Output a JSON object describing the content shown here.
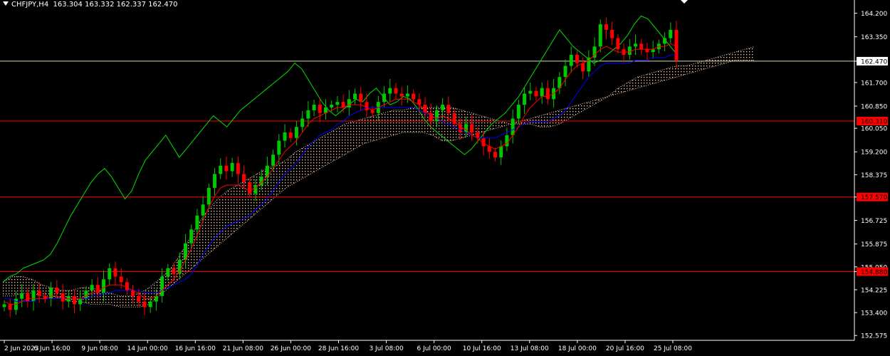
{
  "header": {
    "symbol": "CHFJPY,H4",
    "ohlc": "163.304 163.332 162.337 162.470"
  },
  "chart_data": {
    "type": "candlestick",
    "symbol": "CHFJPY",
    "timeframe": "H4",
    "ylim": [
      152.4,
      164.6
    ],
    "y_ticks": [
      "164.200",
      "163.350",
      "162.470",
      "161.700",
      "160.850",
      "160.050",
      "159.200",
      "158.375",
      "157.570",
      "156.725",
      "155.875",
      "155.050",
      "154.880",
      "154.225",
      "153.400",
      "152.575"
    ],
    "x_ticks": [
      "2 Jun 2023",
      "6 Jun 16:00",
      "9 Jun 08:00",
      "14 Jun 00:00",
      "16 Jun 16:00",
      "21 Jun 08:00",
      "26 Jun 00:00",
      "28 Jun 16:00",
      "3 Jul 08:00",
      "6 Jul 00:00",
      "10 Jul 16:00",
      "13 Jul 08:00",
      "18 Jul 00:00",
      "20 Jul 16:00",
      "25 Jul 08:00"
    ],
    "horizontal_lines": [
      {
        "label": "162.470",
        "price": 162.47,
        "color": "#d8d8a8",
        "label_bg": "#ffffff",
        "label_color": "#000000"
      },
      {
        "label": "160.310",
        "price": 160.31,
        "color": "#ff0000",
        "label_bg": "#ff0000",
        "label_color": "#000000"
      },
      {
        "label": "157.570",
        "price": 157.57,
        "color": "#ff0000",
        "label_bg": "#ff0000",
        "label_color": "#000000"
      },
      {
        "label": "154.880",
        "price": 154.88,
        "color": "#ff0000",
        "label_bg": "#ff0000",
        "label_color": "#000000"
      }
    ],
    "candles": {
      "up_color": "#00c800",
      "down_color": "#ff0000",
      "closes": [
        153.7,
        153.5,
        153.9,
        154.1,
        153.8,
        154.2,
        154.0,
        153.9,
        154.3,
        154.1,
        153.8,
        154.0,
        153.7,
        153.9,
        154.2,
        154.4,
        154.1,
        154.6,
        155.0,
        154.7,
        154.5,
        154.2,
        154.0,
        153.8,
        153.6,
        153.8,
        154.0,
        154.7,
        155.0,
        154.8,
        155.3,
        155.9,
        156.4,
        156.9,
        157.3,
        157.9,
        158.4,
        158.7,
        158.5,
        158.8,
        158.4,
        158.1,
        157.7,
        158.0,
        158.3,
        158.7,
        159.1,
        159.6,
        159.9,
        159.7,
        160.1,
        160.4,
        160.7,
        160.9,
        160.6,
        160.8,
        160.9,
        161.0,
        160.8,
        161.1,
        161.3,
        161.0,
        160.7,
        160.6,
        161.0,
        161.3,
        161.5,
        161.3,
        161.2,
        161.3,
        161.1,
        160.9,
        160.6,
        160.3,
        160.7,
        160.9,
        160.6,
        160.2,
        159.9,
        160.2,
        159.9,
        159.7,
        159.4,
        159.2,
        159.0,
        159.4,
        159.8,
        160.4,
        160.9,
        161.3,
        161.4,
        161.2,
        161.5,
        161.1,
        161.5,
        161.9,
        162.3,
        162.7,
        162.4,
        162.1,
        162.6,
        163.0,
        163.8,
        163.6,
        163.3,
        162.9,
        162.7,
        163.0,
        163.1,
        162.9,
        162.8,
        162.9,
        163.1,
        163.3,
        163.6,
        162.5
      ]
    },
    "indicators": [
      {
        "name": "",
        "type": "ichimoku_tenkan",
        "color": "#ff0000",
        "values": [
          153.8,
          153.7,
          153.7,
          153.8,
          153.9,
          153.9,
          153.9,
          153.9,
          154.0,
          154.0,
          153.9,
          153.9,
          153.9,
          153.9,
          154.0,
          154.1,
          154.2,
          154.3,
          154.4,
          154.4,
          154.4,
          154.3,
          154.2,
          154.1,
          153.9,
          153.9,
          154.0,
          154.2,
          154.4,
          154.6,
          154.9,
          155.3,
          155.7,
          156.2,
          156.7,
          157.2,
          157.6,
          157.9,
          158.0,
          158.0,
          158.0,
          157.9,
          157.8,
          157.9,
          158.1,
          158.3,
          158.6,
          158.9,
          159.2,
          159.4,
          159.6,
          159.9,
          160.2,
          160.4,
          160.5,
          160.6,
          160.7,
          160.8,
          160.8,
          160.9,
          160.9,
          160.9,
          160.8,
          160.7,
          160.8,
          160.9,
          161.0,
          161.1,
          161.1,
          161.1,
          161.0,
          160.9,
          160.7,
          160.5,
          160.4,
          160.5,
          160.4,
          160.3,
          160.1,
          160.0,
          159.8,
          159.7,
          159.5,
          159.4,
          159.3,
          159.4,
          159.5,
          159.8,
          160.1,
          160.5,
          160.8,
          161.0,
          161.2,
          161.2,
          161.3,
          161.5,
          161.8,
          162.1,
          162.3,
          162.4,
          162.5,
          162.7,
          162.9,
          163.0,
          162.9,
          162.8,
          162.8,
          162.8,
          162.9,
          162.9,
          162.9,
          162.9,
          163.0,
          163.0,
          163.1,
          163.0
        ]
      },
      {
        "name": "",
        "type": "ichimoku_kijun",
        "color": "#0000ff",
        "values": [
          153.9,
          153.9,
          153.8,
          153.8,
          153.8,
          153.8,
          153.9,
          153.9,
          153.9,
          153.9,
          153.9,
          153.9,
          153.9,
          153.9,
          153.9,
          154.0,
          154.0,
          154.1,
          154.1,
          154.2,
          154.2,
          154.2,
          154.2,
          154.2,
          154.1,
          154.1,
          154.1,
          154.2,
          154.3,
          154.4,
          154.5,
          154.6,
          154.8,
          155.1,
          155.5,
          155.8,
          156.1,
          156.3,
          156.5,
          156.6,
          156.7,
          156.8,
          156.9,
          157.1,
          157.3,
          157.5,
          157.8,
          158.1,
          158.4,
          158.6,
          158.8,
          159.1,
          159.4,
          159.6,
          159.8,
          159.9,
          160.0,
          160.2,
          160.3,
          160.5,
          160.6,
          160.7,
          160.8,
          160.8,
          160.8,
          160.8,
          160.8,
          160.8,
          160.8,
          160.8,
          160.8,
          160.7,
          160.6,
          160.5,
          160.4,
          160.3,
          160.2,
          160.1,
          160.0,
          159.9,
          159.8,
          159.7,
          159.7,
          159.7,
          159.7,
          159.8,
          159.9,
          160.0,
          160.1,
          160.2,
          160.3,
          160.3,
          160.3,
          160.3,
          160.4,
          160.5,
          160.7,
          161.0,
          161.3,
          161.6,
          161.9,
          162.1,
          162.3,
          162.4,
          162.4,
          162.4,
          162.4,
          162.4,
          162.5,
          162.5,
          162.5,
          162.6,
          162.6,
          162.6,
          162.7,
          162.7
        ]
      },
      {
        "name": "",
        "type": "ichimoku_chikou",
        "color": "#00e000",
        "values": [
          154.5,
          154.7,
          154.8,
          155.0,
          155.1,
          155.2,
          155.3,
          155.5,
          155.9,
          156.4,
          156.9,
          157.3,
          157.7,
          158.1,
          158.4,
          158.6,
          158.3,
          157.9,
          157.5,
          157.8,
          158.4,
          158.9,
          159.2,
          159.5,
          159.8,
          159.4,
          159.0,
          159.3,
          159.6,
          159.9,
          160.2,
          160.5,
          160.3,
          160.1,
          160.4,
          160.7,
          160.9,
          161.1,
          161.3,
          161.5,
          161.7,
          161.9,
          162.1,
          162.4,
          162.2,
          161.8,
          161.4,
          161.0,
          160.7,
          160.5,
          160.7,
          160.9,
          161.1,
          161.0,
          161.3,
          161.5,
          161.2,
          160.9,
          161.0,
          161.2,
          161.1,
          160.8,
          160.4,
          160.1,
          159.9,
          159.7,
          159.5,
          159.3,
          159.1,
          159.3,
          159.6,
          159.9,
          160.2,
          160.4,
          160.6,
          160.9,
          161.2,
          161.6,
          162.0,
          162.4,
          162.8,
          163.2,
          163.6,
          163.3,
          163.0,
          162.8,
          162.6,
          162.4,
          162.5,
          162.7,
          162.9,
          163.1,
          163.4,
          163.8,
          164.1,
          164.0,
          163.7,
          163.4,
          163.1,
          162.8
        ]
      },
      {
        "name": "",
        "type": "ichimoku_cloud",
        "color": "#ffd0b0",
        "upper": [
          154.5,
          154.7,
          154.7,
          154.6,
          154.4,
          154.3,
          154.2,
          154.2,
          154.3,
          154.3,
          154.2,
          154.1,
          154.0,
          154.0,
          154.1,
          154.3,
          154.6,
          154.9,
          155.4,
          156.0,
          156.6,
          157.1,
          157.5,
          157.8,
          158.0,
          158.2,
          158.4,
          158.6,
          158.7,
          158.9,
          159.2,
          159.4,
          159.6,
          159.8,
          160.0,
          160.2,
          160.3,
          160.4,
          160.5,
          160.6,
          160.7,
          160.7,
          160.8,
          160.8,
          160.8,
          160.8,
          160.8,
          160.7,
          160.6,
          160.5,
          160.4,
          160.3,
          160.2,
          160.2,
          160.2,
          160.1,
          160.1,
          160.2,
          160.4,
          160.6,
          160.8,
          161.0,
          161.2,
          161.5,
          161.7,
          161.9,
          162.0,
          162.1,
          162.2,
          162.3,
          162.3,
          162.4,
          162.5,
          162.6,
          162.7,
          162.8,
          162.9,
          163.0
        ],
        "lower": [
          154.0,
          154.0,
          154.1,
          154.1,
          154.0,
          154.0,
          153.9,
          153.8,
          153.8,
          153.7,
          153.7,
          153.7,
          153.6,
          153.6,
          153.6,
          153.7,
          154.0,
          154.3,
          154.6,
          154.9,
          155.2,
          155.5,
          155.8,
          156.1,
          156.4,
          156.7,
          157.0,
          157.3,
          157.6,
          157.9,
          158.1,
          158.3,
          158.5,
          158.7,
          158.9,
          159.1,
          159.3,
          159.5,
          159.6,
          159.7,
          159.8,
          159.9,
          159.9,
          159.9,
          159.8,
          159.6,
          159.6,
          159.7,
          159.8,
          159.9,
          160.0,
          160.1,
          160.2,
          160.3,
          160.4,
          160.5,
          160.6,
          160.7,
          160.8,
          160.9,
          161.0,
          161.1,
          161.2,
          161.3,
          161.4,
          161.5,
          161.6,
          161.7,
          161.8,
          161.9,
          162.0,
          162.1,
          162.2,
          162.3,
          162.4,
          162.5,
          162.5,
          162.5
        ]
      }
    ]
  }
}
